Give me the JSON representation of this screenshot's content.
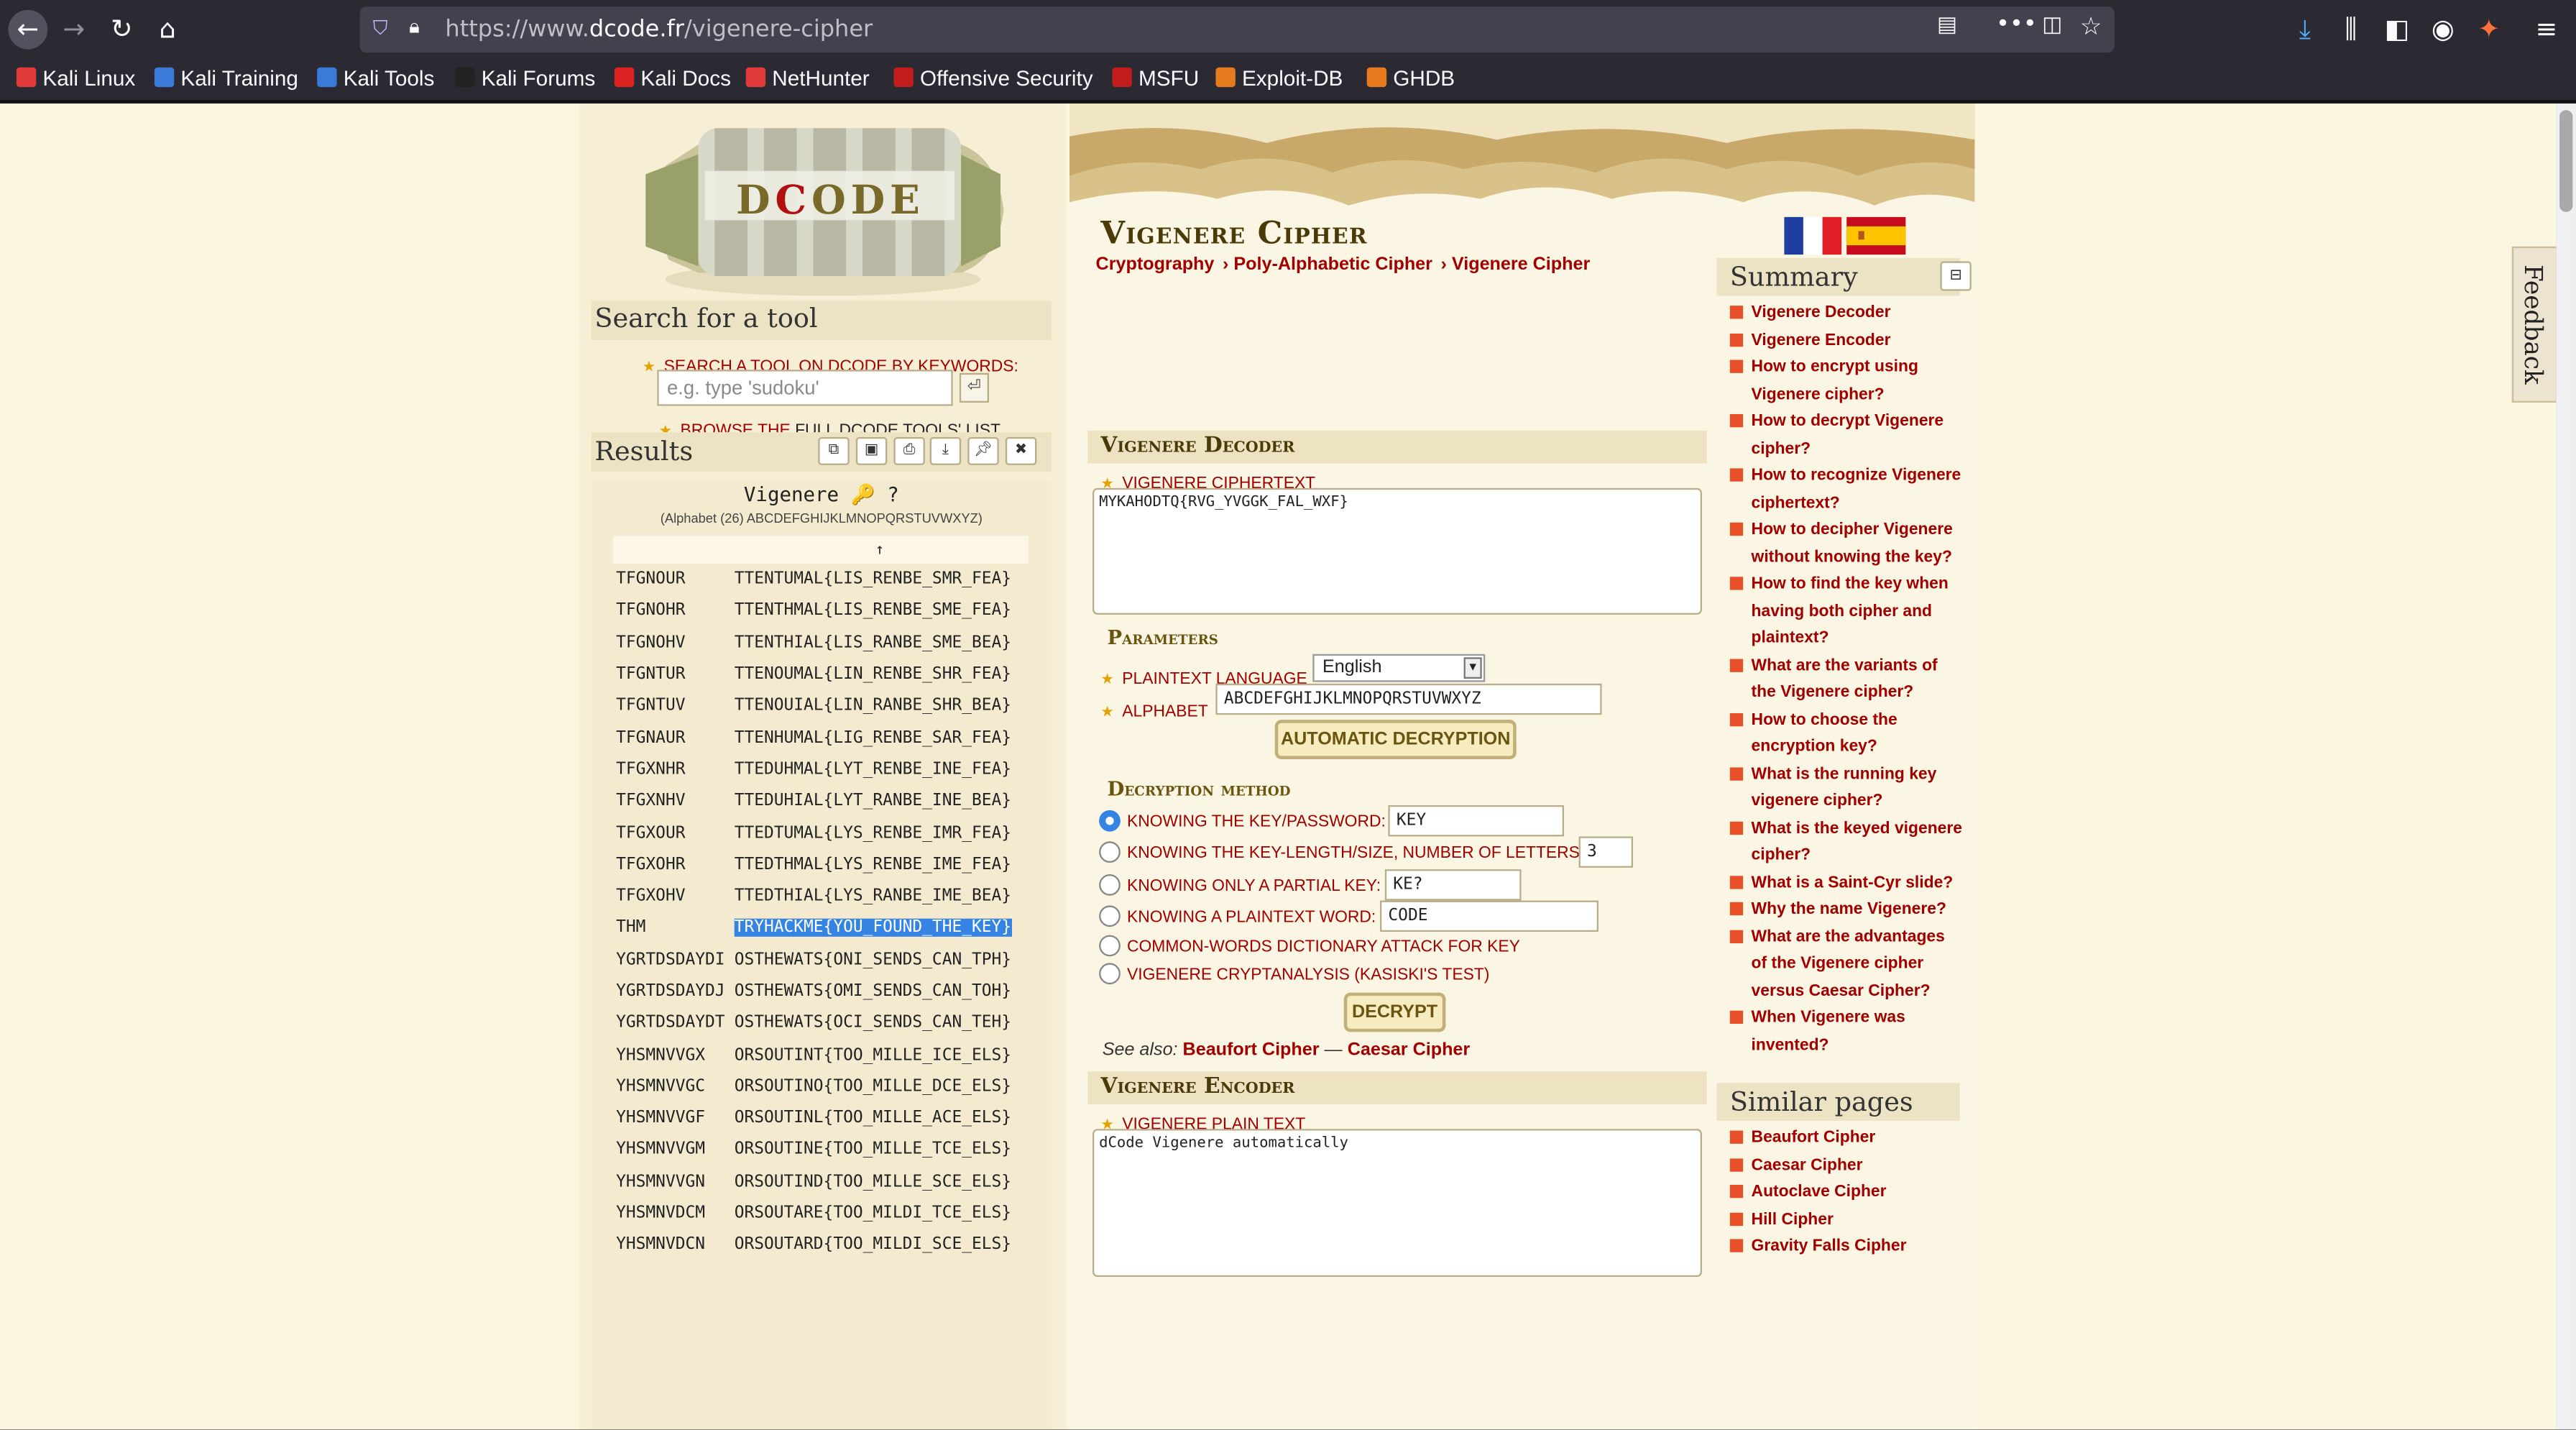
{
  "browser": {
    "url_prefix": "https://www.",
    "url_domain": "dcode.fr",
    "url_path": "/vigenere-cipher",
    "bookmarks": [
      "Kali Linux",
      "Kali Training",
      "Kali Tools",
      "Kali Forums",
      "Kali Docs",
      "NetHunter",
      "Offensive Security",
      "MSFU",
      "Exploit-DB",
      "GHDB"
    ]
  },
  "left": {
    "search_title": "Search for a tool",
    "search_label": "SEARCH A TOOL ON DCODE BY KEYWORDS:",
    "search_placeholder": "e.g. type 'sudoku'",
    "browse_prefix": "BROWSE THE ",
    "browse_link": "FULL DCODE TOOLS' LIST",
    "results_title": "Results",
    "results_header": "Vigenere 🔑 ?",
    "results_alphabet": "(Alphabet (26) ABCDEFGHIJKLMNOPQRSTUVWXYZ)",
    "sort_arrow": "↑",
    "rows": [
      {
        "key": "TFGNOUR",
        "text": "TTENTUMAL{LIS_RENBE_SMR_FEA}"
      },
      {
        "key": "TFGNOHR",
        "text": "TTENTHMAL{LIS_RENBE_SME_FEA}"
      },
      {
        "key": "TFGNOHV",
        "text": "TTENTHIAL{LIS_RANBE_SME_BEA}"
      },
      {
        "key": "TFGNTUR",
        "text": "TTENOUMAL{LIN_RENBE_SHR_FEA}"
      },
      {
        "key": "TFGNTUV",
        "text": "TTENOUIAL{LIN_RANBE_SHR_BEA}"
      },
      {
        "key": "TFGNAUR",
        "text": "TTENHUMAL{LIG_RENBE_SAR_FEA}"
      },
      {
        "key": "TFGXNHR",
        "text": "TTEDUHMAL{LYT_RENBE_INE_FEA}"
      },
      {
        "key": "TFGXNHV",
        "text": "TTEDUHIAL{LYT_RANBE_INE_BEA}"
      },
      {
        "key": "TFGXOUR",
        "text": "TTEDTUMAL{LYS_RENBE_IMR_FEA}"
      },
      {
        "key": "TFGXOHR",
        "text": "TTEDTHMAL{LYS_RENBE_IME_FEA}"
      },
      {
        "key": "TFGXOHV",
        "text": "TTEDTHIAL{LYS_RANBE_IME_BEA}"
      },
      {
        "key": "THM",
        "text": "TRYHACKME{YOU_FOUND_THE_KEY}",
        "selected": true
      },
      {
        "key": "YGRTDSDAYDI",
        "text": "OSTHEWATS{ONI_SENDS_CAN_TPH}"
      },
      {
        "key": "YGRTDSDAYDJ",
        "text": "OSTHEWATS{OMI_SENDS_CAN_TOH}"
      },
      {
        "key": "YGRTDSDAYDT",
        "text": "OSTHEWATS{OCI_SENDS_CAN_TEH}"
      },
      {
        "key": "YHSMNVVGX",
        "text": "ORSOUTINT{TOO_MILLE_ICE_ELS}"
      },
      {
        "key": "YHSMNVVGC",
        "text": "ORSOUTINO{TOO_MILLE_DCE_ELS}"
      },
      {
        "key": "YHSMNVVGF",
        "text": "ORSOUTINL{TOO_MILLE_ACE_ELS}"
      },
      {
        "key": "YHSMNVVGM",
        "text": "ORSOUTINE{TOO_MILLE_TCE_ELS}"
      },
      {
        "key": "YHSMNVVGN",
        "text": "ORSOUTIND{TOO_MILLE_SCE_ELS}"
      },
      {
        "key": "YHSMNVDCM",
        "text": "ORSOUTARE{TOO_MILDI_TCE_ELS}"
      },
      {
        "key": "YHSMNVDCN",
        "text": "ORSOUTARD{TOO_MILDI_SCE_ELS}"
      }
    ]
  },
  "main": {
    "title": "Vigenere Cipher",
    "breadcrumbs": [
      "Cryptography",
      "› Poly-Alphabetic Cipher",
      "› Vigenere Cipher"
    ],
    "decoder": {
      "heading": "Vigenere Decoder",
      "ciphertext_label": "VIGENERE CIPHERTEXT",
      "ciphertext": "MYKAHODTQ{RVG_YVGGK_FAL_WXF}",
      "parameters": "Parameters",
      "language_label": "PLAINTEXT LANGUAGE",
      "language": "English",
      "alphabet_label": "ALPHABET",
      "alphabet": "ABCDEFGHIJKLMNOPQRSTUVWXYZ",
      "auto_button": "AUTOMATIC DECRYPTION",
      "method_heading": "Decryption method",
      "methods": [
        {
          "label": "KNOWING THE KEY/PASSWORD:",
          "value": "KEY",
          "selected": true
        },
        {
          "label": "KNOWING THE KEY-LENGTH/SIZE, NUMBER OF LETTERS:",
          "value": "3"
        },
        {
          "label": "KNOWING ONLY A PARTIAL KEY:",
          "value": "KE?"
        },
        {
          "label": "KNOWING A PLAINTEXT WORD:",
          "value": "CODE"
        },
        {
          "label": "COMMON-WORDS DICTIONARY ATTACK FOR KEY"
        },
        {
          "label": "VIGENERE CRYPTANALYSIS (KASISKI'S TEST)"
        }
      ],
      "decrypt_button": "DECRYPT",
      "see_also": "See also:",
      "see_also_1": "Beaufort Cipher",
      "see_also_sep": " — ",
      "see_also_2": "Caesar Cipher"
    },
    "encoder": {
      "heading": "Vigenere Encoder",
      "plaintext_label": "VIGENERE PLAIN TEXT",
      "plaintext": "dCode Vigenere automatically"
    }
  },
  "right": {
    "summary_title": "Summary",
    "collapse_icon": "⊟",
    "summary": [
      "Vigenere Decoder",
      "Vigenere Encoder",
      "How to encrypt using Vigenere cipher?",
      "How to decrypt Vigenere cipher?",
      "How to recognize Vigenere ciphertext?",
      "How to decipher Vigenere without knowing the key?",
      "How to find the key when having both cipher and plaintext?",
      "What are the variants of the Vigenere cipher?",
      "How to choose the encryption key?",
      "What is the running key vigenere cipher?",
      "What is the keyed vigenere cipher?",
      "What is a Saint-Cyr slide?",
      "Why the name Vigenere?",
      "What are the advantages of the Vigenere cipher versus Caesar Cipher?",
      "When Vigenere was invented?"
    ],
    "similar_title": "Similar pages",
    "similar": [
      "Beaufort Cipher",
      "Caesar Cipher",
      "Autoclave Cipher",
      "Hill Cipher",
      "Gravity Falls Cipher"
    ],
    "feedback": "Feedback"
  },
  "colors": {
    "accent_red": "#a00000",
    "heading_brown": "#4a3a08",
    "selection_blue": "#3584e4"
  }
}
